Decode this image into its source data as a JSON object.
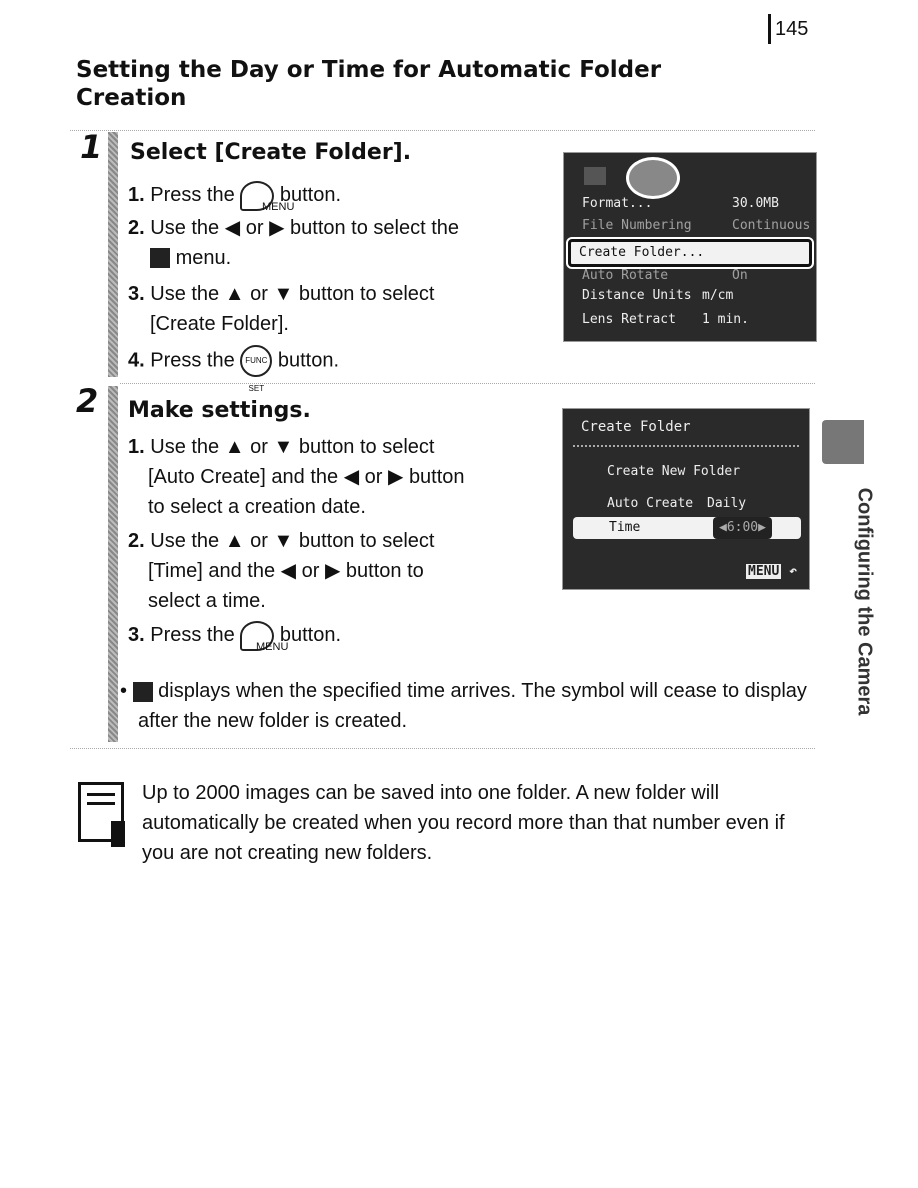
{
  "page_number": "145",
  "title": "Setting the Day or Time for Automatic Folder Creation",
  "step1": {
    "num": "1",
    "heading": "Select [Create Folder].",
    "items": [
      {
        "n": "1.",
        "a": "Press the",
        "b": "button.",
        "btn": "MENU"
      },
      {
        "n": "2.",
        "a": "Use the",
        "or": "or",
        "b": "button to select the",
        "c": "menu."
      },
      {
        "n": "3.",
        "a": "Use the",
        "or": "or",
        "b": "button to select",
        "c": "[Create Folder]."
      },
      {
        "n": "4.",
        "a": "Press the",
        "b": "button.",
        "btn": "FUNC SET"
      }
    ],
    "screen": {
      "rows": [
        [
          "Format...",
          "30.0MB"
        ],
        [
          "File Numbering",
          "Continuous"
        ],
        [
          "Create Folder...",
          ""
        ],
        [
          "Auto Rotate",
          "On"
        ],
        [
          "Distance Units",
          "m/cm"
        ],
        [
          "Lens Retract",
          "1 min."
        ]
      ]
    }
  },
  "step2": {
    "num": "2",
    "heading": "Make settings.",
    "items": [
      {
        "n": "1.",
        "a": "Use the",
        "or": "or",
        "b": "button to select",
        "c": "[Auto Create] and the",
        "or2": "or",
        "d": "button",
        "e": "to select a creation date."
      },
      {
        "n": "2.",
        "a": "Use the",
        "or": "or",
        "b": "button to select",
        "c": "[Time] and the",
        "or2": "or",
        "d": "button to",
        "e": "select a time."
      },
      {
        "n": "3.",
        "a": "Press the",
        "b": "button.",
        "btn": "MENU"
      }
    ],
    "bullet": "displays when the specified time arrives. The symbol will cease to display after the new folder is created.",
    "screen": {
      "title": "Create Folder",
      "rows": [
        [
          "Create New Folder",
          ""
        ],
        [
          "Auto Create",
          "Daily"
        ],
        [
          "Time",
          "6:00"
        ]
      ],
      "menu": "MENU"
    }
  },
  "note": "Up to 2000 images can be saved into one folder. A new folder will automatically be created when you record more than that number even if you are not creating new folders.",
  "side_tab": "Configuring the Camera"
}
